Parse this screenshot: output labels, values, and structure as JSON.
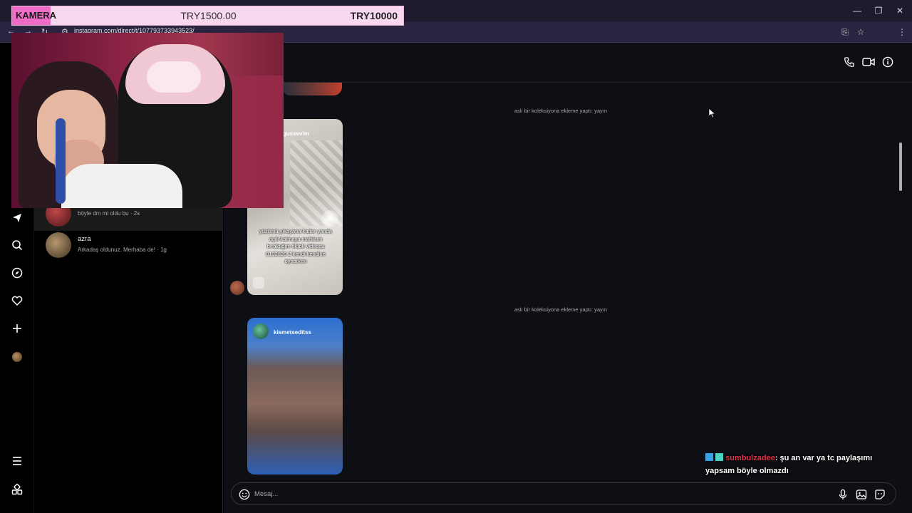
{
  "browser": {
    "url": "instagram.com/direct/t/107793733943523/",
    "controls": {
      "minimize": "—",
      "maximize": "❐",
      "close": "✕"
    }
  },
  "donation": {
    "label": "KAMERA",
    "current": "TRY1500.00",
    "goal": "TRY10000",
    "accent_color": "#f06dc7"
  },
  "conversations": [
    {
      "name": "",
      "preview": "böyle dm mi oldu bu · 2s",
      "active": true
    },
    {
      "name": "azra",
      "preview": "Arkadaş oldunuz. Merhaba de! · 1g",
      "active": false
    }
  ],
  "chat": {
    "system_messages": [
      "aslı bir koleksiyona ekleme yaptı: yayın",
      "aslı bir koleksiyona ekleme yaptı: yayın"
    ],
    "posts": [
      {
        "username": "gussevim",
        "caption": "yüzümü yıkayana kadar yanda açık kalmaya mahkum bıraktığım tiktok videosu 0102829 2 kendi kendine oynarken"
      },
      {
        "username": "kismetseditss",
        "caption": ""
      }
    ],
    "composer_placeholder": "Mesaj..."
  },
  "stream_chat": {
    "username": "sumbulzadee",
    "message": ": şu an var ya tc paylaşımı yapsam böyle olmazdı"
  },
  "icons": {
    "rail": [
      "messenger-icon",
      "search-icon",
      "explore-icon",
      "heart-icon",
      "create-icon",
      "profile-avatar",
      "menu-icon",
      "apps-icon"
    ],
    "header": [
      "phone-icon",
      "video-icon",
      "info-icon"
    ],
    "composer": [
      "emoji-icon",
      "microphone-icon",
      "image-icon",
      "sticker-icon"
    ]
  }
}
